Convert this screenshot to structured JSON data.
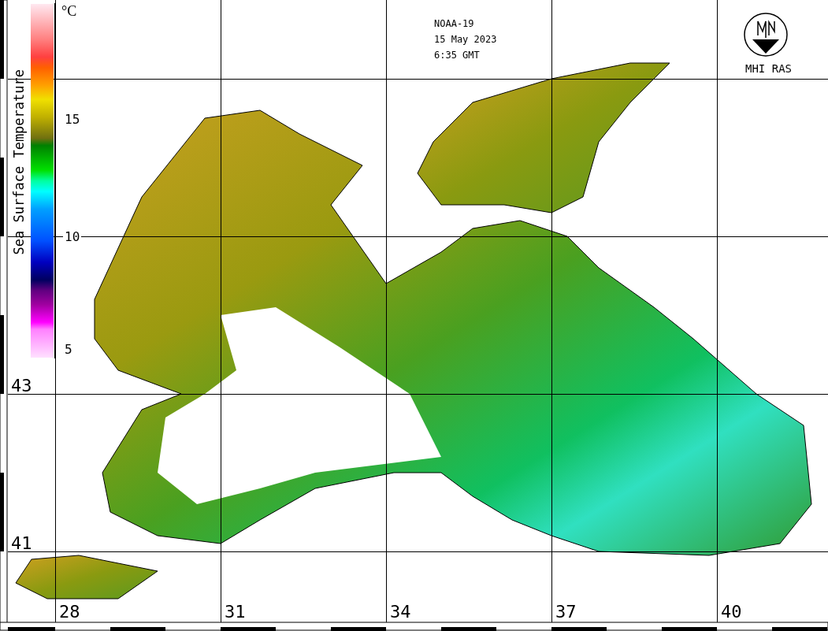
{
  "header": {
    "satellite": "NOAA-19",
    "date": "15 May 2023",
    "time": "6:35 GMT"
  },
  "logo": {
    "label": "MHI RAS"
  },
  "legend": {
    "title": "Sea Surface Temperature",
    "unit": "°C",
    "ticks": [
      "15",
      "10",
      "5"
    ]
  },
  "latitude_labels": [
    "43",
    "41"
  ],
  "longitude_labels": [
    "28",
    "31",
    "34",
    "37",
    "40"
  ]
}
